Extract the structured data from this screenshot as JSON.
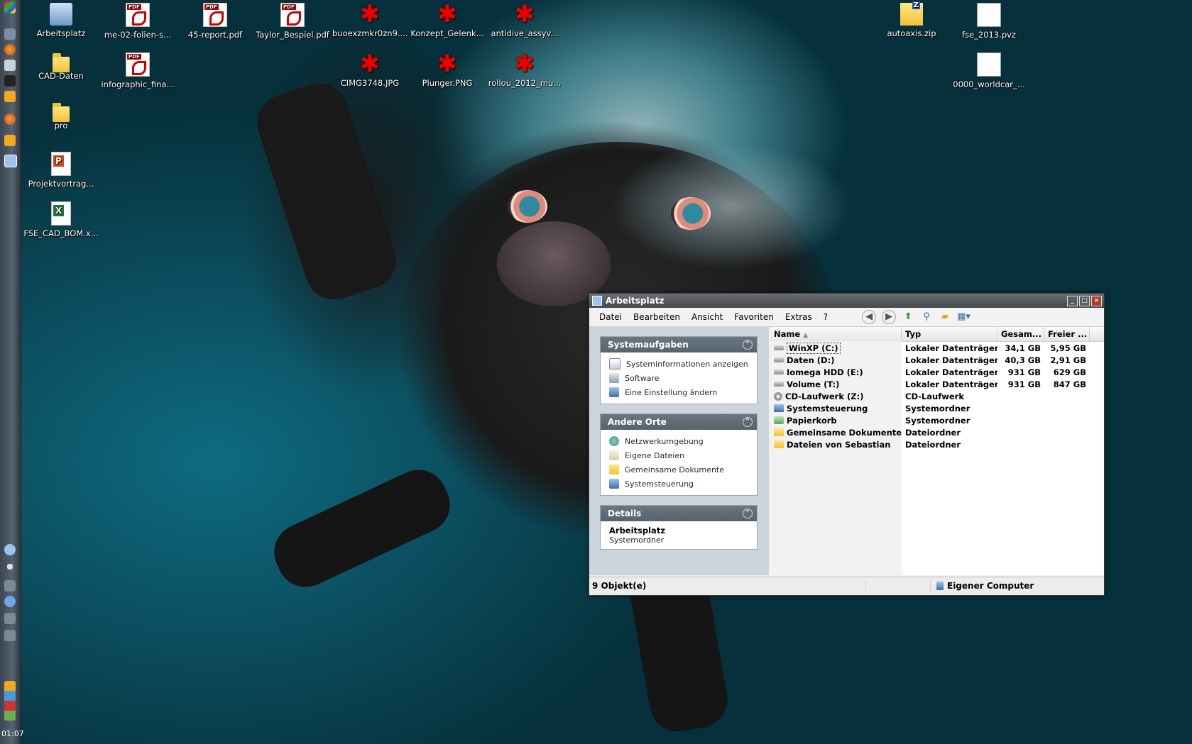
{
  "desktop": {
    "icons": [
      {
        "label": "Arbeitsplatz",
        "icon": "computer-icon"
      },
      {
        "label": "me-02-folien-s...",
        "icon": "pdf-icon"
      },
      {
        "label": "45-report.pdf",
        "icon": "pdf-icon"
      },
      {
        "label": "Taylor_Bespiel.pdf",
        "icon": "pdf-icon"
      },
      {
        "label": "buoexzmkr0zn9....",
        "icon": "image-icon"
      },
      {
        "label": "Konzept_Gelenk...",
        "icon": "image-icon"
      },
      {
        "label": "antidive_assyv...",
        "icon": "image-icon"
      },
      {
        "label": "autoaxis.zip",
        "icon": "zip-icon"
      },
      {
        "label": "fse_2013.pvz",
        "icon": "file-icon"
      },
      {
        "label": "CAD-Daten",
        "icon": "folder-icon"
      },
      {
        "label": "infographic_fina...",
        "icon": "pdf-icon"
      },
      {
        "label": "CIMG3748.JPG",
        "icon": "image-icon"
      },
      {
        "label": "Plunger.PNG",
        "icon": "image-icon"
      },
      {
        "label": "rollou_2012_mu...",
        "icon": "image-icon"
      },
      {
        "label": "0000_worldcar_...",
        "icon": "file-icon"
      },
      {
        "label": "pro",
        "icon": "folder-icon"
      },
      {
        "label": "Projektvortrag...",
        "icon": "powerpoint-icon"
      },
      {
        "label": "FSE_CAD_BOM.x...",
        "icon": "excel-icon"
      }
    ]
  },
  "taskbar": {
    "clock": "01:07"
  },
  "window": {
    "title": "Arbeitsplatz",
    "menu": [
      "Datei",
      "Bearbeiten",
      "Ansicht",
      "Favoriten",
      "Extras",
      "?"
    ],
    "panels": {
      "system": {
        "title": "Systemaufgaben",
        "items": [
          "Systeminformationen anzeigen",
          "Software",
          "Eine Einstellung ändern"
        ]
      },
      "places": {
        "title": "Andere Orte",
        "items": [
          "Netzwerkumgebung",
          "Eigene Dateien",
          "Gemeinsame Dokumente",
          "Systemsteuerung"
        ]
      },
      "details": {
        "title": "Details",
        "name": "Arbeitsplatz",
        "type": "Systemordner"
      }
    },
    "columns": {
      "name": "Name",
      "type": "Typ",
      "total": "Gesam...",
      "free": "Freier ..."
    },
    "rows": [
      {
        "name": "WinXP (C:)",
        "type": "Lokaler Datenträger",
        "total": "34,1 GB",
        "free": "5,95 GB"
      },
      {
        "name": "Daten (D:)",
        "type": "Lokaler Datenträger",
        "total": "40,3 GB",
        "free": "2,91 GB"
      },
      {
        "name": "Iomega HDD (E:)",
        "type": "Lokaler Datenträger",
        "total": "931 GB",
        "free": "629 GB"
      },
      {
        "name": "Volume (T:)",
        "type": "Lokaler Datenträger",
        "total": "931 GB",
        "free": "847 GB"
      },
      {
        "name": "CD-Laufwerk (Z:)",
        "type": "CD-Laufwerk",
        "total": "",
        "free": ""
      },
      {
        "name": "Systemsteuerung",
        "type": "Systemordner",
        "total": "",
        "free": ""
      },
      {
        "name": "Papierkorb",
        "type": "Systemordner",
        "total": "",
        "free": ""
      },
      {
        "name": "Gemeinsame Dokumente",
        "type": "Dateiordner",
        "total": "",
        "free": ""
      },
      {
        "name": "Dateien von Sebastian",
        "type": "Dateiordner",
        "total": "",
        "free": ""
      }
    ],
    "status": {
      "count": "9 Objekt(e)",
      "location": "Eigener Computer"
    }
  }
}
